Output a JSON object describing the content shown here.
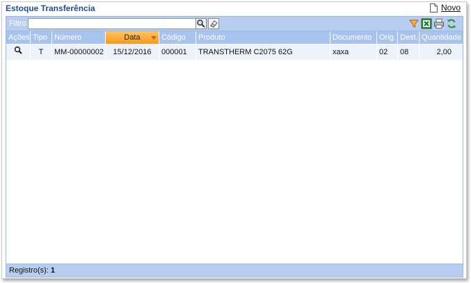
{
  "header": {
    "title": "Estoque Transferência",
    "new_label": "Novo"
  },
  "filter": {
    "label": "Filtro:",
    "value": "",
    "placeholder": ""
  },
  "table": {
    "columns": [
      "Ações",
      "Tipo",
      "Número",
      "Data",
      "Código",
      "Produto",
      "Documento",
      "Orig.",
      "Dest.",
      "Quantidade"
    ],
    "sorted_column": "Data",
    "rows": [
      {
        "tipo": "T",
        "numero": "MM-00000002",
        "data": "15/12/2016",
        "codigo": "000001",
        "produto": "TRANSTHERM C2075 62G",
        "documento": "xaxa",
        "orig": "02",
        "dest": "08",
        "quantidade": "2,00"
      }
    ]
  },
  "footer": {
    "label": "Registro(s):",
    "count": "1"
  },
  "icons": {
    "search": "search-icon",
    "clear": "eraser-icon",
    "filter": "funnel-icon",
    "excel": "excel-icon",
    "print": "printer-icon",
    "refresh": "refresh-icon",
    "view": "magnifier-icon",
    "new": "document-icon"
  },
  "colors": {
    "accent": "#1f4e99",
    "header_bg": "#a8c4ee",
    "sorted_bg": "#f79a1c",
    "row_bg": "#eef2fa"
  }
}
